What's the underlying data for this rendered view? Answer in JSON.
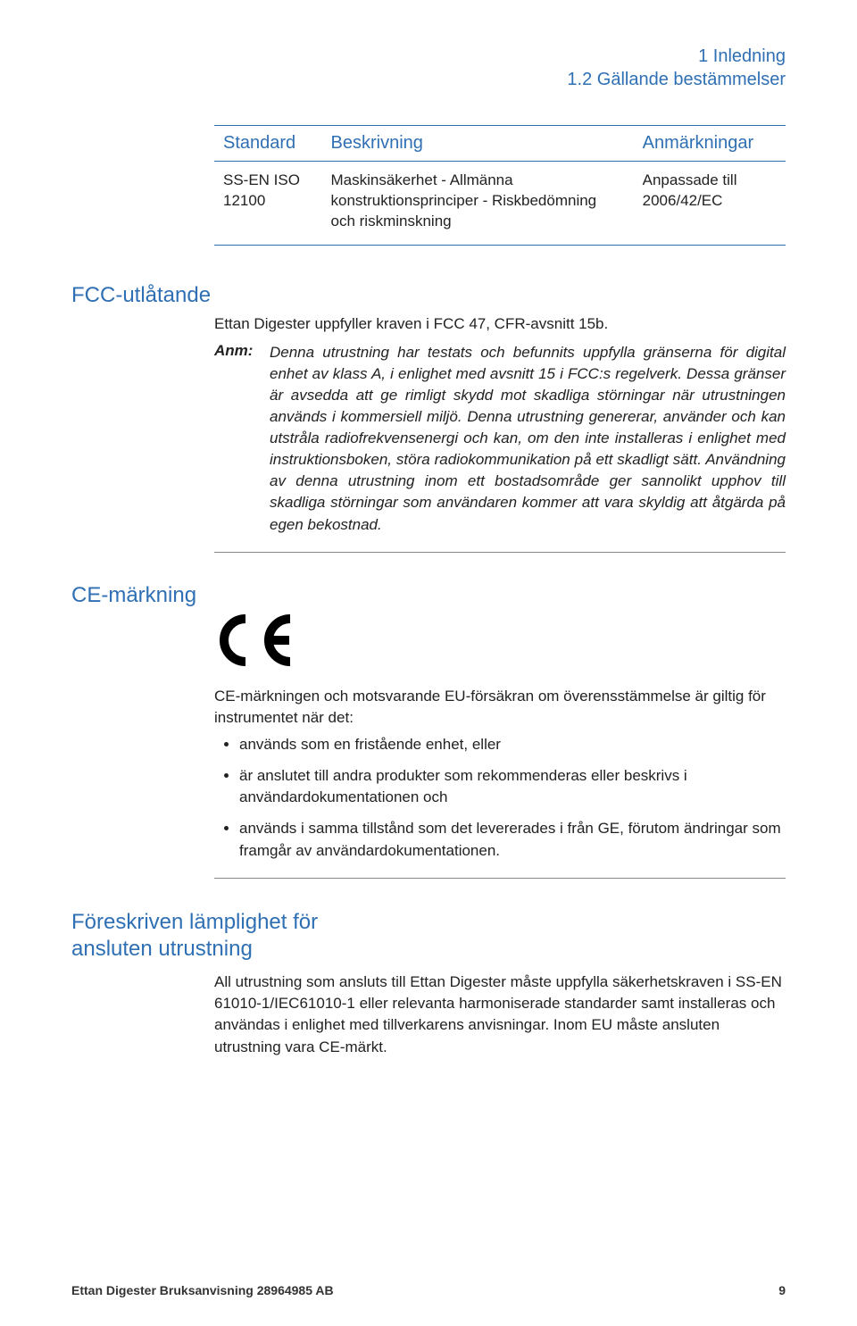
{
  "header": {
    "line1": "1 Inledning",
    "line2": "1.2 Gällande bestämmelser"
  },
  "table": {
    "headers": [
      "Standard",
      "Beskrivning",
      "Anmärkningar"
    ],
    "row": {
      "c0": "SS-EN ISO 12100",
      "c1": "Maskinsäkerhet - Allmänna konstruktionsprinciper - Riskbedömning och riskminskning",
      "c2": "Anpassade till 2006/42/EC"
    }
  },
  "fcc": {
    "title": "FCC-utlåtande",
    "intro": "Ettan Digester uppfyller kraven i FCC 47, CFR-avsnitt 15b.",
    "anm_label": "Anm:",
    "anm_text": "Denna utrustning har testats och befunnits uppfylla gränserna för digital enhet av klass A, i enlighet med avsnitt 15 i FCC:s regelverk. Dessa gränser är avsedda att ge rimligt skydd mot skadliga störningar när utrustningen används i kommersiell miljö. Denna utrustning genererar, använder och kan utstråla radiofrekvensenergi och kan, om den inte installeras i enlighet med instruktionsboken, störa radiokommunikation på ett skadligt sätt. Användning av denna utrustning inom ett bostadsområde ger sannolikt upphov till skadliga störningar som användaren kommer att vara skyldig att åtgärda på egen bekostnad."
  },
  "ce": {
    "title": "CE-märkning",
    "intro": "CE-märkningen och motsvarande EU-försäkran om överensstämmelse är giltig för instrumentet när det:",
    "bullets": [
      "används som en fristående enhet, eller",
      "är anslutet till andra produkter som rekommenderas eller beskrivs i användardokumentationen och",
      "används i samma tillstånd som det levererades i från GE, förutom ändringar som framgår av användardokumentationen."
    ]
  },
  "prescribed": {
    "title_l1": "Föreskriven lämplighet för",
    "title_l2": "ansluten utrustning",
    "text": "All utrustning som ansluts till Ettan Digester måste uppfylla säkerhetskraven i SS-EN 61010-1/IEC61010-1 eller relevanta harmoniserade standarder samt installeras och användas i enlighet med tillverkarens anvisningar. Inom EU måste ansluten utrustning vara CE-märkt."
  },
  "footer": {
    "left": "Ettan Digester Bruksanvisning 28964985 AB",
    "right": "9"
  }
}
